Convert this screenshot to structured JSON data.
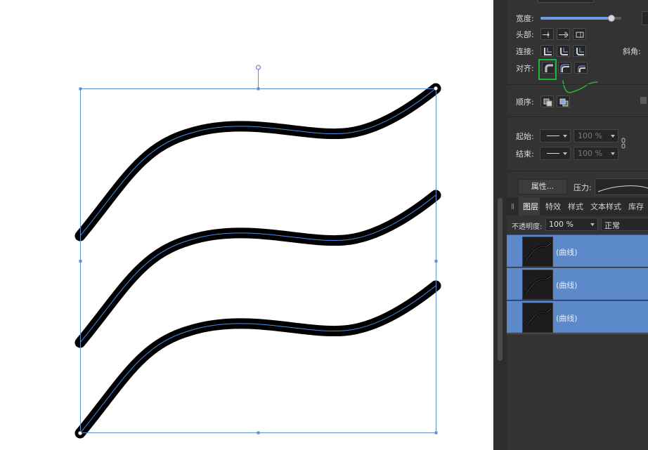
{
  "stroke_panel": {
    "width_label": "宽度:",
    "cap_label": "头部:",
    "join_label": "连接:",
    "miter_label": "斜角:",
    "align_label": "对齐:",
    "order_label": "顺序:",
    "start_label": "起始:",
    "end_label": "结束:",
    "start_scale": "100 %",
    "end_scale": "100 %",
    "properties_button": "属性...",
    "pressure_label": "压力:",
    "width_slider_value": 0.88
  },
  "layers_panel": {
    "tabs": [
      "图层",
      "特效",
      "样式",
      "文本样式",
      "库存"
    ],
    "opacity_label": "不透明度:",
    "opacity_value": "100 %",
    "blend_mode": "正常",
    "layers": [
      {
        "name": "(曲线)"
      },
      {
        "name": "(曲线)"
      },
      {
        "name": "(曲线)"
      }
    ]
  },
  "colors": {
    "panel_bg": "#333333",
    "selection_blue": "#5b89c9",
    "annotation_green": "#21b43c",
    "curve_blue": "#4a90e8"
  }
}
